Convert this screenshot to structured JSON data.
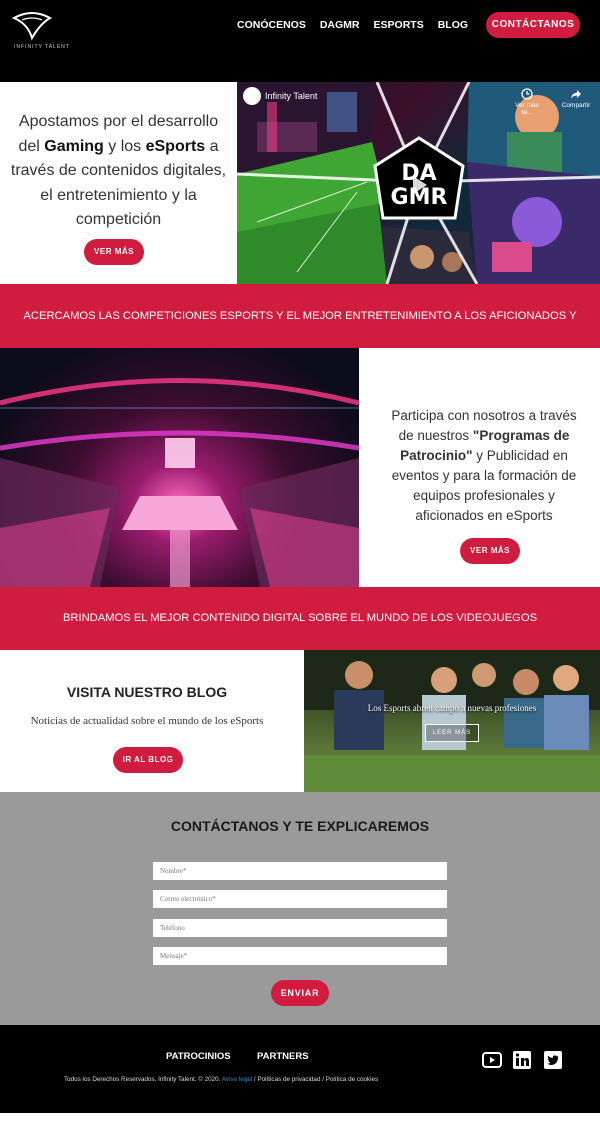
{
  "header": {
    "logo_text": "INFINITY TALENT",
    "nav": [
      "CONÓCENOS",
      "DAGMR",
      "ESPORTS",
      "BLOG"
    ],
    "contact_button": "CONTÁCTANOS"
  },
  "hero": {
    "text_1": "Apostamos por el desarrollo del ",
    "text_bold_1": "Gaming",
    "text_2": " y los ",
    "text_bold_2": "eSports",
    "text_3": " a través de contenidos digitales, el entretenimiento y la competición",
    "button": "VER MÁS"
  },
  "video": {
    "channel": "Infinity Talent",
    "watch_later": "Ver más ta...",
    "share": "Compartir",
    "logo_line1": "DA",
    "logo_line2": "GMR"
  },
  "banner_1": "ACERCAMOS LAS  COMPETICIONES  ESPORTS Y EL MEJOR ENTRETENIMIENTO A LOS AFICIONADOS Y GAMERS",
  "sponsorship": {
    "text_1": "Participa con nosotros a través de nuestros ",
    "text_bold": "\"Programas de Patrocinio\"",
    "text_2": " y Publicidad en eventos y para la formación de equipos profesionales y aficionados en eSports",
    "button": "VER MÁS"
  },
  "banner_2": "BRINDAMOS EL MEJOR CONTENIDO DIGITAL SOBRE EL MUNDO DE LOS VIDEOJUEGOS",
  "blog": {
    "title": "VISITA NUESTRO BLOG",
    "subtitle": "Noticias de actualidad sobre el mundo de los eSports",
    "button": "IR AL BLOG",
    "post_title": "Los Esports abren campo a nuevas profesiones",
    "read_more": "LEER MÁS"
  },
  "contact": {
    "title": "CONTÁCTANOS Y TE EXPLICAREMOS",
    "name_placeholder": "Nombre*",
    "email_placeholder": "Correo electrónico*",
    "phone_placeholder": "Teléfono",
    "message_placeholder": "Mensaje*",
    "submit": "ENVIAR"
  },
  "footer": {
    "links": [
      "PATROCINIOS",
      "PARTNERS"
    ],
    "copyright": "Todos los Derechos Reservados, Infinity Talent. © 2020. ",
    "legal": "Aviso legal",
    "sep1": " / ",
    "privacy": "Políticas de privacidad",
    "sep2": " / ",
    "cookies": "Política de cookies"
  },
  "colors": {
    "accent": "#d01c3f",
    "header_bg": "#000000",
    "contact_bg": "#9a9a9a"
  }
}
